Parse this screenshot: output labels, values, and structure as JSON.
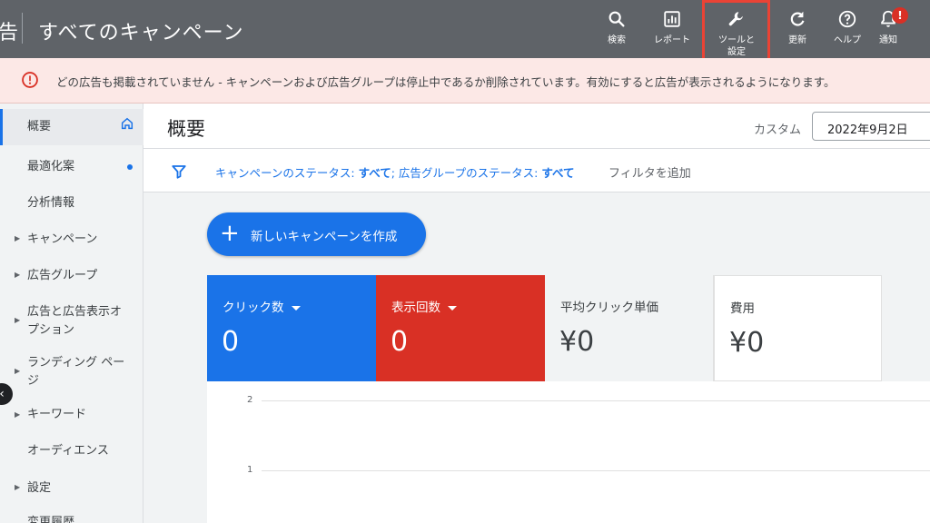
{
  "header": {
    "brand_fragment": "告",
    "title": "すべてのキャンペーン",
    "tools": [
      {
        "icon": "search-icon",
        "label": "検索"
      },
      {
        "icon": "report-icon",
        "label": "レポート"
      },
      {
        "icon": "wrench-icon",
        "label": "ツールと\n設定"
      },
      {
        "icon": "refresh-icon",
        "label": "更新"
      },
      {
        "icon": "help-icon",
        "label": "ヘルプ"
      },
      {
        "icon": "bell-icon",
        "label": "通知"
      }
    ],
    "notification_badge": "!"
  },
  "alert": {
    "icon": "error-icon",
    "text": "どの広告も掲載されていません - キャンペーンおよび広告グループは停止中であるか削除されています。有効にすると広告が表示されるようになります。"
  },
  "sidebar": {
    "items": [
      {
        "label": "概要",
        "active": true
      },
      {
        "label": "最適化案"
      },
      {
        "label": "分析情報"
      },
      {
        "label": "キャンペーン"
      },
      {
        "label": "広告グループ"
      },
      {
        "label": "広告と広告表示オ\nプション"
      },
      {
        "label": "ランディング ペー\nジ"
      },
      {
        "label": "キーワード"
      },
      {
        "label": "オーディエンス"
      },
      {
        "label": "設定"
      },
      {
        "label": "変更履歴"
      }
    ],
    "collapse_icon": "chevron-left-icon"
  },
  "main": {
    "page_title": "概要",
    "date_label": "カスタム",
    "date_value": "2022年9月2日",
    "filter": {
      "icon": "filter-icon",
      "campaign_status_label": "キャンペーンのステータス: ",
      "campaign_status_value": "すべて",
      "separator": "; ",
      "adgroup_status_label": "広告グループのステータス: ",
      "adgroup_status_value": "すべて",
      "add_filter": "フィルタを追加"
    },
    "create_button": "新しいキャンペーンを作成",
    "metrics": [
      {
        "title": "クリック数",
        "value": "0",
        "color": "#1a73e8"
      },
      {
        "title": "表示回数",
        "value": "0",
        "color": "#d93025"
      },
      {
        "title": "平均クリック単価",
        "value": "¥0"
      },
      {
        "title": "費用",
        "value": "¥0"
      }
    ],
    "chart_ticks": [
      "2",
      "1"
    ]
  },
  "colors": {
    "topbar": "#5f6368",
    "accent": "#1a73e8",
    "alert_bg": "#fce8e6",
    "error": "#d93025"
  }
}
